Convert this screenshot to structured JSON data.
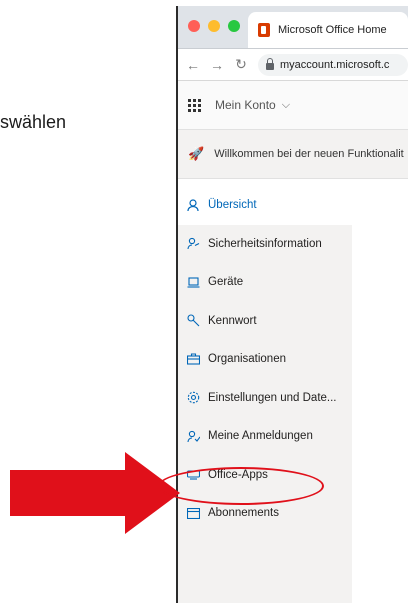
{
  "document": {
    "fragment_text": "swählen"
  },
  "browser": {
    "tab_title": "Microsoft Office Home",
    "url_text": "myaccount.microsoft.c"
  },
  "app": {
    "title": "Mein Konto",
    "banner_text": "Willkommen bei der neuen Funktionalit"
  },
  "sidebar": {
    "items": [
      {
        "label": "Übersicht",
        "icon": "person-icon",
        "active": true
      },
      {
        "label": "Sicherheitsinformation",
        "icon": "security-person-icon",
        "active": false
      },
      {
        "label": "Geräte",
        "icon": "laptop-icon",
        "active": false
      },
      {
        "label": "Kennwort",
        "icon": "key-icon",
        "active": false
      },
      {
        "label": "Organisationen",
        "icon": "briefcase-icon",
        "active": false
      },
      {
        "label": "Einstellungen und Date...",
        "icon": "gear-icon",
        "active": false
      },
      {
        "label": "Meine Anmeldungen",
        "icon": "signin-person-icon",
        "active": false
      },
      {
        "label": "Office-Apps",
        "icon": "office-apps-icon",
        "active": false
      },
      {
        "label": "Abonnements",
        "icon": "subscription-icon",
        "active": false
      }
    ]
  },
  "annotations": {
    "arrow_color": "#e0101a",
    "highlight_target": "Office-Apps"
  },
  "colors": {
    "accent": "#0067b8",
    "sidebar_bg": "#f3f2f1",
    "annotation_red": "#e0101a"
  }
}
